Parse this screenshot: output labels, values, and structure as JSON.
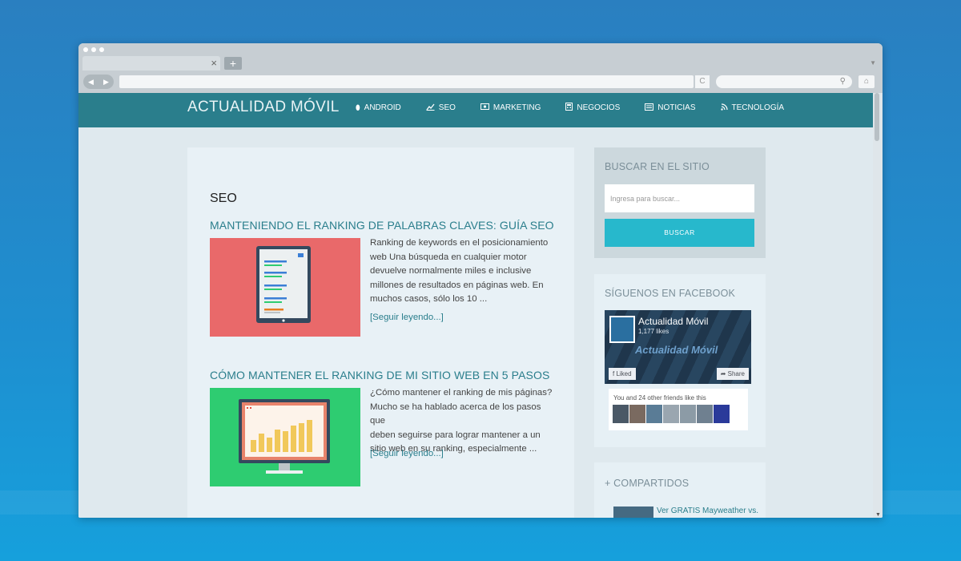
{
  "browser": {
    "tab_close": "×",
    "new_tab": "+",
    "back": "◀",
    "forward": "▶",
    "reload": "C",
    "search_icon": "🔍",
    "home_icon": "⌂"
  },
  "site": {
    "logo": "ACTUALIDAD MÓVIL",
    "menu": [
      {
        "icon": "android-icon",
        "glyph": "⬮",
        "label": "ANDROID"
      },
      {
        "icon": "chart-icon",
        "glyph": "📈",
        "label": "SEO"
      },
      {
        "icon": "money-icon",
        "glyph": "▣",
        "label": "MARKETING"
      },
      {
        "icon": "calculator-icon",
        "glyph": "▦",
        "label": "NEGOCIOS"
      },
      {
        "icon": "newspaper-icon",
        "glyph": "▤",
        "label": "NOTICIAS"
      },
      {
        "icon": "rss-icon",
        "glyph": "⌇",
        "label": "TECNOLOGÍA"
      }
    ]
  },
  "main": {
    "section_title": "SEO",
    "posts": [
      {
        "title": "MANTENIENDO EL RANKING DE PALABRAS CLAVES: GUÍA SEO",
        "excerpt_lines": [
          "Ranking de keywords en el posicionamiento",
          "web Una búsqueda en cualquier motor",
          "devuelve normalmente miles e inclusive",
          "millones de resultados en páginas web. En",
          "muchos casos, sólo los 10 ..."
        ],
        "read_more": "[Seguir leyendo...]",
        "thumb_color": "#e9696a"
      },
      {
        "title": "CÓMO MANTENER EL RANKING DE MI SITIO WEB EN 5 PASOS",
        "excerpt_lines": [
          "¿Cómo mantener el ranking de mis páginas?",
          "Mucho se ha hablado acerca de los pasos que",
          "deben seguirse para lograr mantener a un",
          "sitio web en su ranking, especialmente ..."
        ],
        "read_more": "[Seguir leyendo...]",
        "thumb_color": "#2ecc71"
      }
    ]
  },
  "sidebar": {
    "search": {
      "title": "BUSCAR EN EL SITIO",
      "placeholder": "Ingresa para buscar...",
      "button": "BUSCAR"
    },
    "facebook": {
      "title": "SÍGUENOS EN FACEBOOK",
      "page_name": "Actualidad Móvil",
      "likes": "1,177 likes",
      "brand": "Actualidad Móvil",
      "liked_button": "Liked",
      "share_button": "Share",
      "friends_text": "You and 24 other friends like this"
    },
    "shared": {
      "title": "+ COMPARTIDOS",
      "item": "Ver GRATIS Mayweather vs."
    }
  }
}
